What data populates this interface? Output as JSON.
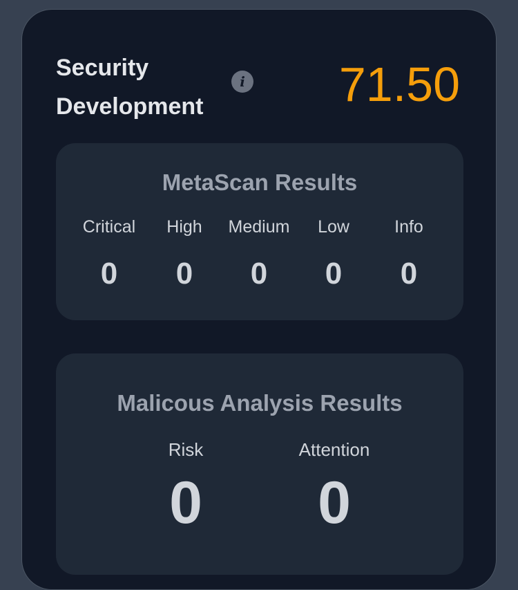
{
  "header": {
    "title_line1": "Security",
    "title_line2": "Development",
    "info_icon": "info-icon",
    "score": "71.50",
    "score_color": "#f59e0b"
  },
  "metascan": {
    "title": "MetaScan Results",
    "columns": [
      {
        "label": "Critical",
        "value": "0"
      },
      {
        "label": "High",
        "value": "0"
      },
      {
        "label": "Medium",
        "value": "0"
      },
      {
        "label": "Low",
        "value": "0"
      },
      {
        "label": "Info",
        "value": "0"
      }
    ]
  },
  "malicious": {
    "title": "Malicous Analysis Results",
    "columns": [
      {
        "label": "Risk",
        "value": "0"
      },
      {
        "label": "Attention",
        "value": "0"
      }
    ]
  }
}
